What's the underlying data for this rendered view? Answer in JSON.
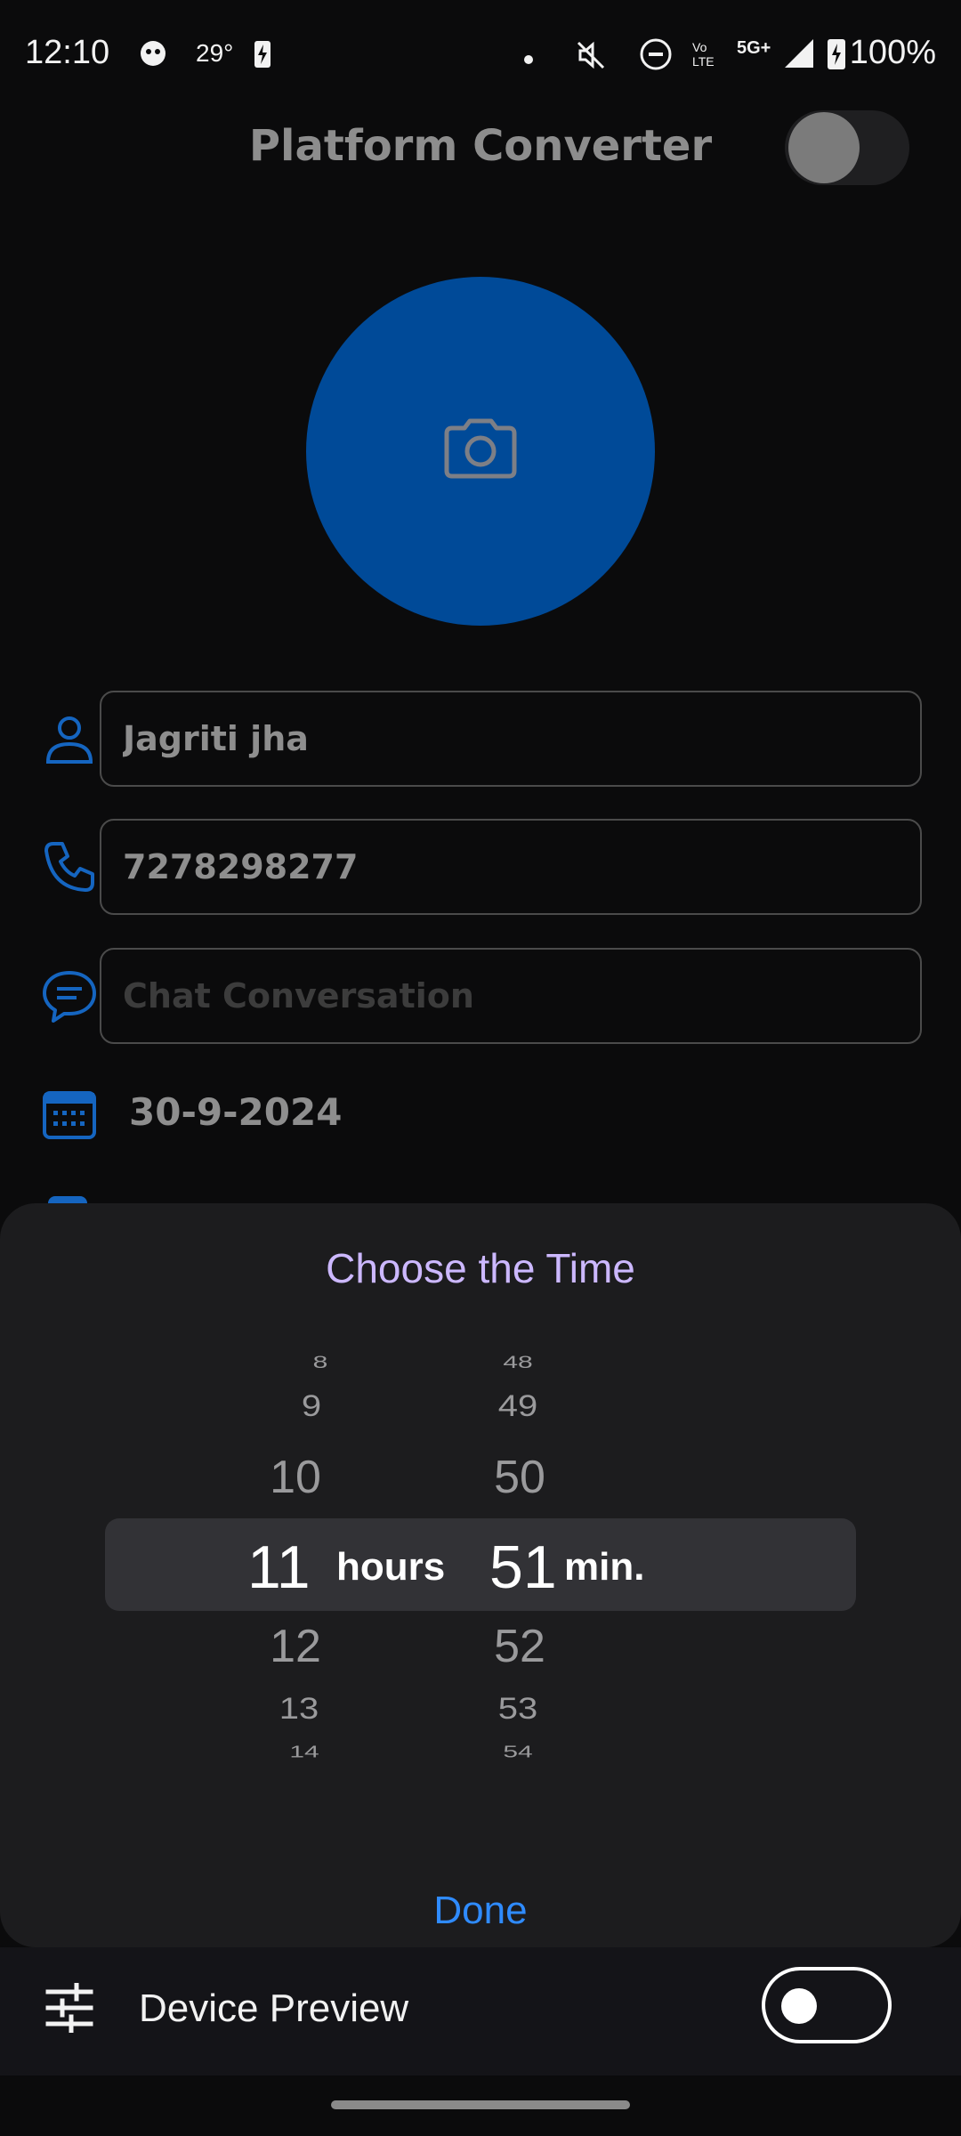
{
  "status_bar": {
    "time": "12:10",
    "temperature": "29°",
    "battery": "100%"
  },
  "app": {
    "title": "Platform Converter"
  },
  "form": {
    "name_value": "Jagriti jha",
    "phone_value": "7278298277",
    "chat_placeholder": "Chat Conversation",
    "date": "30-9-2024"
  },
  "time_picker": {
    "title": "Choose the Time",
    "hours_wheel": [
      "8",
      "9",
      "10",
      "11",
      "12",
      "13",
      "14"
    ],
    "minutes_wheel": [
      "48",
      "49",
      "50",
      "51",
      "52",
      "53",
      "54"
    ],
    "selected_hour": "11",
    "selected_minute": "51",
    "hours_unit": "hours",
    "minutes_unit": "min.",
    "done_label": "Done"
  },
  "bottom_bar": {
    "label": "Device Preview"
  },
  "colors": {
    "accent_blue": "#004a98",
    "title_lilac": "#ccb8ff",
    "done_blue": "#2f8bff"
  }
}
